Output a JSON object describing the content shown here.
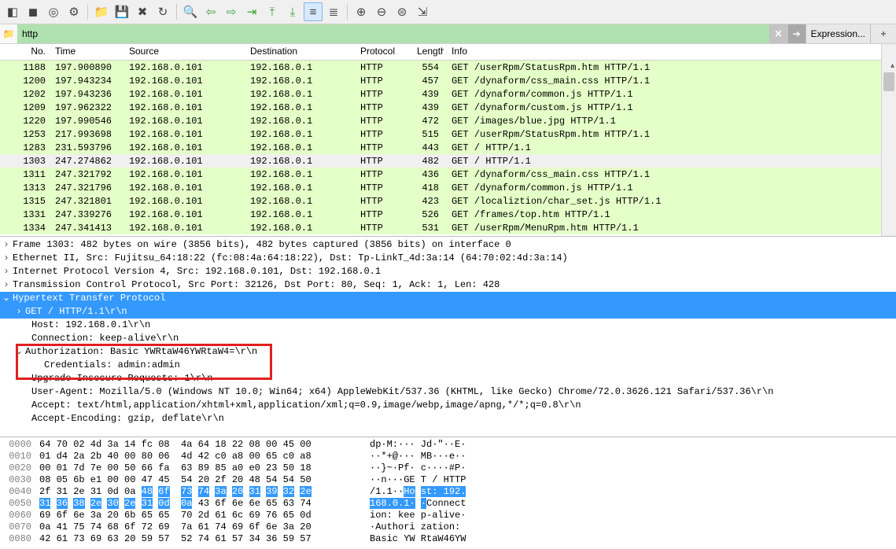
{
  "filter": {
    "value": "http",
    "expression_label": "Expression...",
    "add_label": "+"
  },
  "columns": {
    "no": "No.",
    "time": "Time",
    "source": "Source",
    "destination": "Destination",
    "protocol": "Protocol",
    "length": "Length",
    "info": "Info"
  },
  "packets": [
    {
      "no": "1188",
      "time": "197.900890",
      "src": "192.168.0.101",
      "dst": "192.168.0.1",
      "proto": "HTTP",
      "len": "554",
      "info": "GET /userRpm/StatusRpm.htm HTTP/1.1",
      "cls": "http"
    },
    {
      "no": "1200",
      "time": "197.943234",
      "src": "192.168.0.101",
      "dst": "192.168.0.1",
      "proto": "HTTP",
      "len": "457",
      "info": "GET /dynaform/css_main.css HTTP/1.1",
      "cls": "http"
    },
    {
      "no": "1202",
      "time": "197.943236",
      "src": "192.168.0.101",
      "dst": "192.168.0.1",
      "proto": "HTTP",
      "len": "439",
      "info": "GET /dynaform/common.js HTTP/1.1",
      "cls": "http"
    },
    {
      "no": "1209",
      "time": "197.962322",
      "src": "192.168.0.101",
      "dst": "192.168.0.1",
      "proto": "HTTP",
      "len": "439",
      "info": "GET /dynaform/custom.js HTTP/1.1",
      "cls": "http"
    },
    {
      "no": "1220",
      "time": "197.990546",
      "src": "192.168.0.101",
      "dst": "192.168.0.1",
      "proto": "HTTP",
      "len": "472",
      "info": "GET /images/blue.jpg HTTP/1.1",
      "cls": "http"
    },
    {
      "no": "1253",
      "time": "217.993698",
      "src": "192.168.0.101",
      "dst": "192.168.0.1",
      "proto": "HTTP",
      "len": "515",
      "info": "GET /userRpm/StatusRpm.htm HTTP/1.1",
      "cls": "http"
    },
    {
      "no": "1283",
      "time": "231.593796",
      "src": "192.168.0.101",
      "dst": "192.168.0.1",
      "proto": "HTTP",
      "len": "443",
      "info": "GET / HTTP/1.1",
      "cls": "http"
    },
    {
      "no": "1303",
      "time": "247.274862",
      "src": "192.168.0.101",
      "dst": "192.168.0.1",
      "proto": "HTTP",
      "len": "482",
      "info": "GET / HTTP/1.1",
      "cls": "sel"
    },
    {
      "no": "1311",
      "time": "247.321792",
      "src": "192.168.0.101",
      "dst": "192.168.0.1",
      "proto": "HTTP",
      "len": "436",
      "info": "GET /dynaform/css_main.css HTTP/1.1",
      "cls": "http"
    },
    {
      "no": "1313",
      "time": "247.321796",
      "src": "192.168.0.101",
      "dst": "192.168.0.1",
      "proto": "HTTP",
      "len": "418",
      "info": "GET /dynaform/common.js HTTP/1.1",
      "cls": "http"
    },
    {
      "no": "1315",
      "time": "247.321801",
      "src": "192.168.0.101",
      "dst": "192.168.0.1",
      "proto": "HTTP",
      "len": "423",
      "info": "GET /localiztion/char_set.js HTTP/1.1",
      "cls": "http"
    },
    {
      "no": "1331",
      "time": "247.339276",
      "src": "192.168.0.101",
      "dst": "192.168.0.1",
      "proto": "HTTP",
      "len": "526",
      "info": "GET /frames/top.htm HTTP/1.1",
      "cls": "http"
    },
    {
      "no": "1334",
      "time": "247.341413",
      "src": "192.168.0.101",
      "dst": "192.168.0.1",
      "proto": "HTTP",
      "len": "531",
      "info": "GET /userRpm/MenuRpm.htm HTTP/1.1",
      "cls": "http"
    }
  ],
  "details": {
    "frame": "Frame 1303: 482 bytes on wire (3856 bits), 482 bytes captured (3856 bits) on interface 0",
    "eth": "Ethernet II, Src: Fujitsu_64:18:22 (fc:08:4a:64:18:22), Dst: Tp-LinkT_4d:3a:14 (64:70:02:4d:3a:14)",
    "ip": "Internet Protocol Version 4, Src: 192.168.0.101, Dst: 192.168.0.1",
    "tcp": "Transmission Control Protocol, Src Port: 32126, Dst Port: 80, Seq: 1, Ack: 1, Len: 428",
    "http": "Hypertext Transfer Protocol",
    "get": "GET / HTTP/1.1\\r\\n",
    "host": "Host: 192.168.0.1\\r\\n",
    "conn": "Connection: keep-alive\\r\\n",
    "auth": "Authorization: Basic YWRtaW46YWRtaW4=\\r\\n",
    "cred": "Credentials: admin:admin",
    "upgrade": "Upgrade-Insecure-Requests: 1\\r\\n",
    "ua": "User-Agent: Mozilla/5.0 (Windows NT 10.0; Win64; x64) AppleWebKit/537.36 (KHTML, like Gecko) Chrome/72.0.3626.121 Safari/537.36\\r\\n",
    "accept": "Accept: text/html,application/xhtml+xml,application/xml;q=0.9,image/webp,image/apng,*/*;q=0.8\\r\\n",
    "accenc": "Accept-Encoding: gzip, deflate\\r\\n"
  },
  "hex": [
    {
      "off": "0000",
      "b": "64 70 02 4d 3a 14 fc 08  4a 64 18 22 08 00 45 00",
      "a": "dp·M:··· Jd·\"··E·",
      "m0": -1,
      "m1": -1,
      "am0": -1,
      "am1": -1
    },
    {
      "off": "0010",
      "b": "01 d4 2a 2b 40 00 80 06  4d 42 c0 a8 00 65 c0 a8",
      "a": "··*+@··· MB···e··",
      "m0": -1,
      "m1": -1,
      "am0": -1,
      "am1": -1
    },
    {
      "off": "0020",
      "b": "00 01 7d 7e 00 50 66 fa  63 89 85 a0 e0 23 50 18",
      "a": "··}~·Pf· c····#P·",
      "m0": -1,
      "m1": -1,
      "am0": -1,
      "am1": -1
    },
    {
      "off": "0030",
      "b": "08 05 6b e1 00 00 47 45  54 20 2f 20 48 54 54 50",
      "a": "··n···GE T / HTTP",
      "m0": -1,
      "m1": -1,
      "am0": -1,
      "am1": -1
    },
    {
      "off": "0040",
      "b": "2f 31 2e 31 0d 0a 48 6f  73 74 3a 20 31 39 32 2e",
      "a": "/1.1··Ho st: 192.",
      "m0": 6,
      "m1": 16,
      "am0": 6,
      "am1": 17
    },
    {
      "off": "0050",
      "b": "31 36 38 2e 30 2e 31 0d  0a 43 6f 6e 6e 65 63 74",
      "a": "168.0.1· ·Connect",
      "m0": 0,
      "m1": 9,
      "am0": 0,
      "am1": 9
    },
    {
      "off": "0060",
      "b": "69 6f 6e 3a 20 6b 65 65  70 2d 61 6c 69 76 65 0d",
      "a": "ion: kee p-alive·",
      "m0": -1,
      "m1": -1,
      "am0": -1,
      "am1": -1
    },
    {
      "off": "0070",
      "b": "0a 41 75 74 68 6f 72 69  7a 61 74 69 6f 6e 3a 20",
      "a": "·Authori zation: ",
      "m0": -1,
      "m1": -1,
      "am0": -1,
      "am1": -1
    },
    {
      "off": "0080",
      "b": "42 61 73 69 63 20 59 57  52 74 61 57 34 36 59 57",
      "a": "Basic YW RtaW46YW",
      "m0": -1,
      "m1": -1,
      "am0": -1,
      "am1": -1
    }
  ],
  "icons": {
    "folder": "📁",
    "clear": "✕",
    "go": "➔",
    "paint": "◧",
    "square": "◼",
    "target": "◎",
    "gear": "⚙",
    "folder2": "📁",
    "save": "💾",
    "close_doc": "✖",
    "reload": "↻",
    "find": "🔍",
    "back": "⇦",
    "fwd": "⇨",
    "jump": "⇥",
    "first": "⤒",
    "last": "⤓",
    "autoscroll": "≡",
    "autoscroll2": "≣",
    "zin": "⊕",
    "zout": "⊖",
    "z1": "⊜",
    "resize": "⇲"
  }
}
